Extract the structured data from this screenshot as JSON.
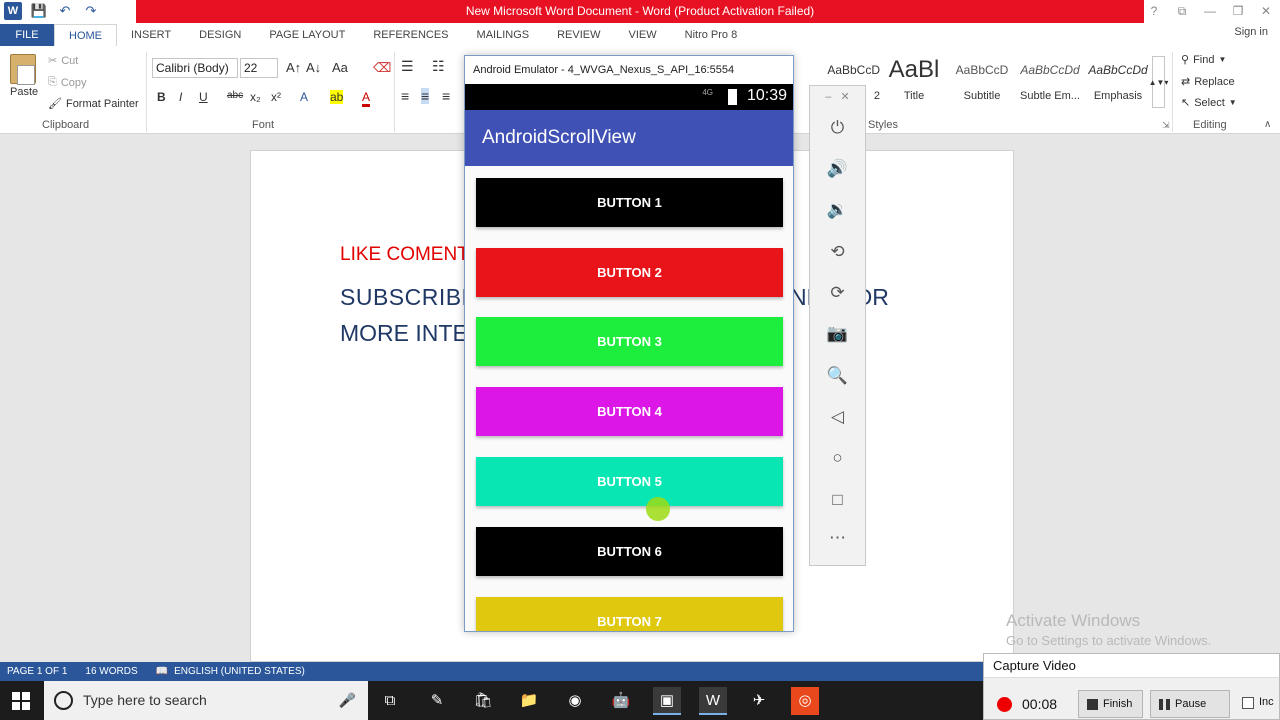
{
  "window": {
    "title": "New Microsoft Word Document -  Word (Product Activation Failed)",
    "controls": [
      "?",
      "⧉",
      "—",
      "❐",
      "✕"
    ]
  },
  "ribbon_tabs": [
    "FILE",
    "HOME",
    "INSERT",
    "DESIGN",
    "PAGE LAYOUT",
    "REFERENCES",
    "MAILINGS",
    "REVIEW",
    "VIEW",
    "Nitro Pro 8"
  ],
  "active_tab": "HOME",
  "signin": "Sign in",
  "clipboard": {
    "paste": "Paste",
    "cut": "Cut",
    "copy": "Copy",
    "format_painter": "Format Painter",
    "label": "Clipboard"
  },
  "font": {
    "family": "Calibri (Body)",
    "size": "22",
    "label": "Font",
    "case_btn": "Aa",
    "color_btn": "A"
  },
  "format_buttons": [
    "B",
    "I",
    "U",
    "abc",
    "x₂",
    "x²"
  ],
  "styles": {
    "label": "Styles",
    "items": [
      {
        "sample": "AaBbCcD",
        "name": "2",
        "big": false
      },
      {
        "sample": "AaBl",
        "name": "Title",
        "big": true
      },
      {
        "sample": "AaBbCcD",
        "name": "Subtitle",
        "big": false
      },
      {
        "sample": "AaBbCcDd",
        "name": "Subtle Em...",
        "big": false
      },
      {
        "sample": "AaBbCcDd",
        "name": "Emphasis",
        "big": false
      }
    ]
  },
  "editing": {
    "find": "Find",
    "replace": "Replace",
    "select": "Select",
    "label": "Editing"
  },
  "document": {
    "line1": "LIKE COMENT",
    "line2": "SUBSCRIBE",
    "line2_tail": "NEL FOR",
    "line3": "MORE INTE"
  },
  "activate": {
    "title": "Activate Windows",
    "subtitle": "Go to Settings to activate Windows."
  },
  "statusbar": {
    "page": "PAGE 1 OF 1",
    "words": "16 WORDS",
    "language": "ENGLISH (UNITED STATES)"
  },
  "emulator": {
    "title": "Android Emulator - 4_WVGA_Nexus_S_API_16:5554",
    "clock": "10:39",
    "network": "4G",
    "app_title": "AndroidScrollView",
    "buttons": [
      {
        "label": "BUTTON 1",
        "color": "#000000"
      },
      {
        "label": "BUTTON 2",
        "color": "#e8141a"
      },
      {
        "label": "BUTTON 3",
        "color": "#1ded3c"
      },
      {
        "label": "BUTTON 4",
        "color": "#dd16e8"
      },
      {
        "label": "BUTTON 5",
        "color": "#08e6b4"
      },
      {
        "label": "BUTTON 6",
        "color": "#000000"
      },
      {
        "label": "BUTTON 7",
        "color": "#dfc80e"
      }
    ],
    "side_tools": [
      "power-icon",
      "volume-up-icon",
      "volume-down-icon",
      "rotate-left-icon",
      "rotate-right-icon",
      "camera-icon",
      "zoom-icon",
      "back-icon",
      "home-icon",
      "overview-icon",
      "more-icon"
    ]
  },
  "taskbar": {
    "search_placeholder": "Type here to search",
    "apps": [
      "task-view-icon",
      "app-icon",
      "store-icon",
      "file-explorer-icon",
      "chrome-icon",
      "android-studio-icon",
      "emulator-icon",
      "word-icon",
      "misc-icon",
      "recorder-icon"
    ]
  },
  "capture": {
    "title": "Capture Video",
    "time": "00:08",
    "finish": "Finish",
    "pause": "Pause",
    "include": "Inc"
  },
  "colors": {
    "word_blue": "#2b579a",
    "activation_red": "#e81123",
    "app_bar": "#3f51b5"
  }
}
